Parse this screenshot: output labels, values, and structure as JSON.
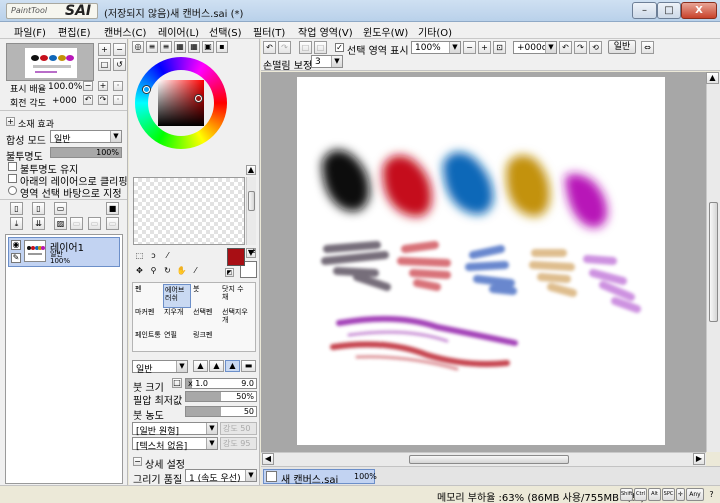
{
  "window": {
    "logo_small": "PaintTool",
    "logo_big": "SAI",
    "title": "(저장되지 않음)새 캔버스.sai (*)",
    "controls": [
      "–",
      "□",
      "X"
    ]
  },
  "menu": [
    "파일(F)",
    "편집(E)",
    "캔버스(C)",
    "레이어(L)",
    "선택(S)",
    "필터(T)",
    "작업 영역(V)",
    "윈도우(W)",
    "기타(O)"
  ],
  "navigator": {
    "zoom_label": "표시 배율",
    "zoom_value": "100.0%",
    "rotate_label": "회전 각도",
    "rotate_value": "+000"
  },
  "layer_props": {
    "effect_label": "소재 효과",
    "blend_label": "합성 모드",
    "blend_value": "일반",
    "opacity_label": "불투명도",
    "opacity_value": "100%",
    "options": [
      "불투명도 유지",
      "아래의 레이어으로 클리핑",
      "영역 선택 바탕으로 지정"
    ]
  },
  "layers": [
    {
      "name": "레이어1",
      "mode": "일반",
      "opacity": "100%"
    }
  ],
  "canvas_toolbar": {
    "selection_label": "선택 영역 표시",
    "zoom": "100%",
    "rotate": "+000o",
    "blend": "일반",
    "stabilizer_label": "손떨림 보정",
    "stabilizer_value": "3"
  },
  "tools": [
    {
      "label": "펜",
      "selected": false
    },
    {
      "label": "에어브러쉬",
      "selected": true
    },
    {
      "label": "붓",
      "selected": false
    },
    {
      "label": "닷지 수채",
      "selected": false
    },
    {
      "label": "마커펜",
      "selected": false
    },
    {
      "label": "지우개",
      "selected": false
    },
    {
      "label": "선택펜",
      "selected": false
    },
    {
      "label": "선택지우개",
      "selected": false
    },
    {
      "label": "페인트통",
      "selected": false
    },
    {
      "label": "연필",
      "selected": false
    },
    {
      "label": "링크펜",
      "selected": false
    }
  ],
  "brush": {
    "mode": "일반",
    "size_label": "붓 크기",
    "size_mult": "x 1.0",
    "size_value": "9.0",
    "min_size_label": "필압 최저값",
    "min_size_value": "50%",
    "density_label": "붓 농도",
    "density_value": "50",
    "shape": "[일반 원형]",
    "shape_amount": "강도 50",
    "texture": "[텍스처 없음]",
    "texture_amount": "강도 95",
    "detail_label": "상세 설정",
    "quality_label": "그리기 품질",
    "quality_value": "1 (속도 우선)"
  },
  "colors": {
    "primary": "#a80e14",
    "secondary": "#ffffff",
    "accent": "#6c8fc9"
  },
  "statusbar": {
    "tab_name": "새 캔버스.sai",
    "tab_zoom": "100%",
    "memory": "메모리 부하율 :63% (86MB 사용/755MB 확보)",
    "keys": [
      "Shift",
      "Ctrl",
      "Alt",
      "SPC"
    ],
    "any": "Any"
  },
  "painting": {
    "blobs": [
      {
        "color": "#0b0b0b"
      },
      {
        "color": "#c5101c"
      },
      {
        "color": "#1167b8"
      },
      {
        "color": "#c39208"
      },
      {
        "color": "#b816b8"
      }
    ]
  }
}
